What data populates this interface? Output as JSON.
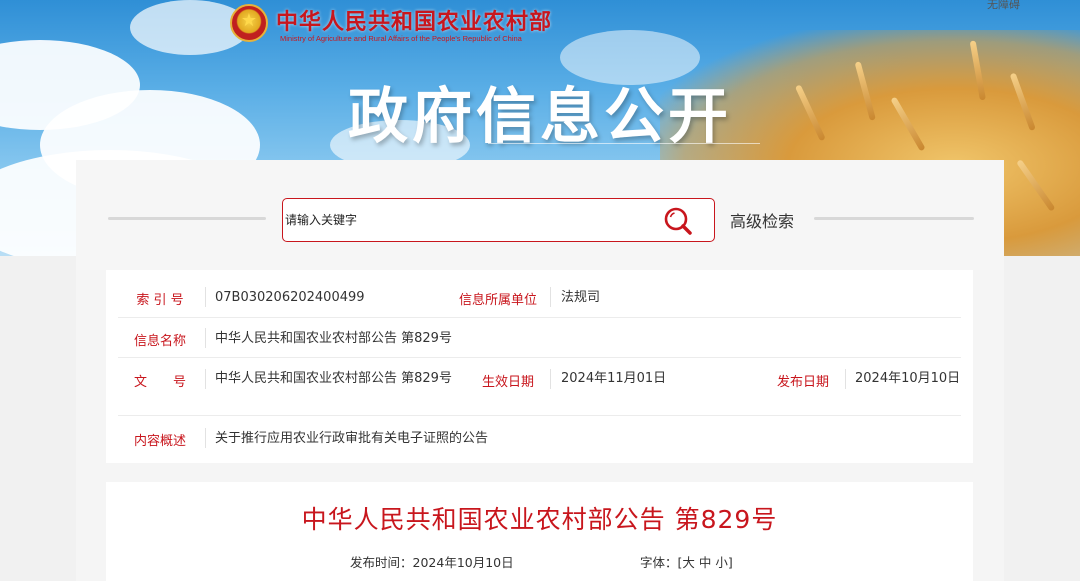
{
  "header": {
    "ministry_name": "中华人民共和国农业农村部",
    "ministry_name_en": "Ministry of Agriculture and Rural Affairs of the People's Republic of China",
    "accessibility_link": "无障碍",
    "banner_title": "政府信息公开"
  },
  "search": {
    "placeholder": "请输入关键字",
    "advanced_label": "高级检索",
    "icon": "search-icon"
  },
  "info": {
    "index_label": "索 引 号",
    "index_value": "07B030206202400499",
    "unit_label": "信息所属单位",
    "unit_value": "法规司",
    "name_label": "信息名称",
    "name_value": "中华人民共和国农业农村部公告 第829号",
    "doc_no_label": "文　　号",
    "doc_no_value": "中华人民共和国农业农村部公告 第829号",
    "effective_label": "生效日期",
    "effective_value": "2024年11月01日",
    "publish_label": "发布日期",
    "publish_value": "2024年10月10日",
    "summary_label": "内容概述",
    "summary_value": "关于推行应用农业行政审批有关电子证照的公告"
  },
  "article": {
    "title": "中华人民共和国农业农村部公告 第829号",
    "publish_time_label": "发布时间：",
    "publish_time_value": "2024年10月10日",
    "font_label": "字体：",
    "font_open": "[",
    "font_large": "大",
    "font_medium": "中",
    "font_small": "小",
    "font_close": "]"
  },
  "colors": {
    "accent_red": "#c8161d",
    "text": "#333333"
  }
}
